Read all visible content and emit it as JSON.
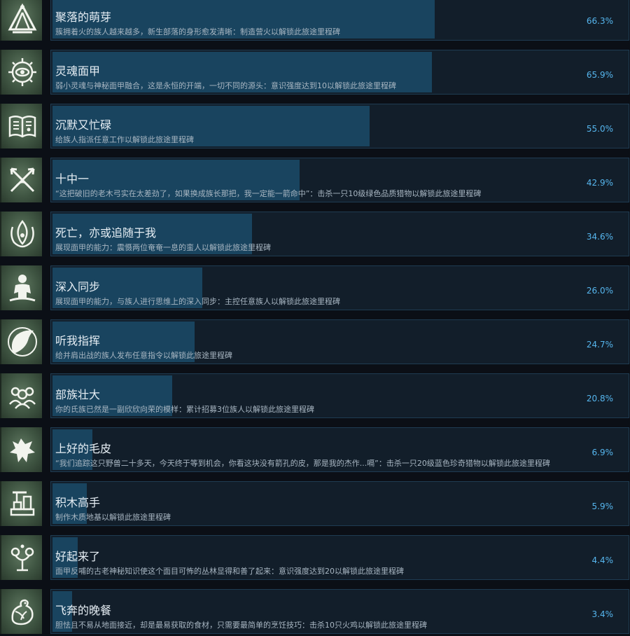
{
  "colors": {
    "page_background": "#0b0f16",
    "row_background": "#121e2a",
    "row_border": "#1f3c52",
    "progress_fill": "#19445f",
    "title_text": "#e6eef4",
    "description_text": "#a8b6c2",
    "percent_text": "#56b6ee",
    "icon_tile": "#4b6350",
    "icon_glyph": "#f2f4ee"
  },
  "achievements": [
    {
      "title": "聚落的萌芽",
      "description": "簇拥着火的族人越来越多，新生部落的身形愈发清晰：制造营火以解锁此旅途里程碑",
      "percent_label": "66.3%",
      "unlock_rate": 0.663,
      "icon": "tribe-tent-icon"
    },
    {
      "title": "灵魂面甲",
      "description": "弱小灵魂与神秘面甲融合，这是永恒的开端，一切不同的源头：意识强度达到10以解锁此旅途里程碑",
      "percent_label": "65.9%",
      "unlock_rate": 0.659,
      "icon": "spirit-mask-icon"
    },
    {
      "title": "沉默又忙碌",
      "description": "给族人指派任意工作以解锁此旅途里程碑",
      "percent_label": "55.0%",
      "unlock_rate": 0.55,
      "icon": "open-book-icon"
    },
    {
      "title": "十中一",
      "description": "“这把破旧的老木弓实在太差劲了，如果换成族长那把，我一定能一箭命中”：击杀一只10级绿色品质猎物以解锁此旅途里程碑",
      "percent_label": "42.9%",
      "unlock_rate": 0.429,
      "icon": "crossed-arrows-icon"
    },
    {
      "title": "死亡，亦或追随于我",
      "description": "展现面甲的能力：震慑两位奄奄一息的蛮人以解锁此旅途里程碑",
      "percent_label": "34.6%",
      "unlock_rate": 0.346,
      "icon": "flame-emblem-icon"
    },
    {
      "title": "深入同步",
      "description": "展现面甲的能力，与族人进行思维上的深入同步：主控任意族人以解锁此旅途里程碑",
      "percent_label": "26.0%",
      "unlock_rate": 0.26,
      "icon": "meditating-figure-icon"
    },
    {
      "title": "听我指挥",
      "description": "给并肩出战的族人发布任意指令以解锁此旅途里程碑",
      "percent_label": "24.7%",
      "unlock_rate": 0.247,
      "icon": "war-horn-icon"
    },
    {
      "title": "部族壮大",
      "description": "你的氏族已然是一副欣欣向荣的模样：累计招募3位族人以解锁此旅途里程碑",
      "percent_label": "20.8%",
      "unlock_rate": 0.208,
      "icon": "group-people-icon"
    },
    {
      "title": "上好的毛皮",
      "description": "“我们追踪这只野兽二十多天，今天终于等到机会，你看这块没有箭孔的皮，那是我的杰作...嗝”：击杀一只20级蓝色珍奇猎物以解锁此旅途里程碑",
      "percent_label": "6.9%",
      "unlock_rate": 0.069,
      "icon": "beast-pelt-icon"
    },
    {
      "title": "积木高手",
      "description": "制作木质地基以解锁此旅途里程碑",
      "percent_label": "5.9%",
      "unlock_rate": 0.059,
      "icon": "building-blocks-icon"
    },
    {
      "title": "好起来了",
      "description": "面甲反哺的古老神秘知识使这个面目可怖的丛林显得和善了起来：意识强度达到20以解锁此旅途里程碑",
      "percent_label": "4.4%",
      "unlock_rate": 0.044,
      "icon": "mystic-sigil-icon"
    },
    {
      "title": "飞奔的晚餐",
      "description": "胆怯且不易从地面接近，却是最易获取的食材，只需要最简单的烹饪技巧：击杀10只火鸡以解锁此旅途里程碑",
      "percent_label": "3.4%",
      "unlock_rate": 0.034,
      "icon": "turkey-icon"
    }
  ]
}
